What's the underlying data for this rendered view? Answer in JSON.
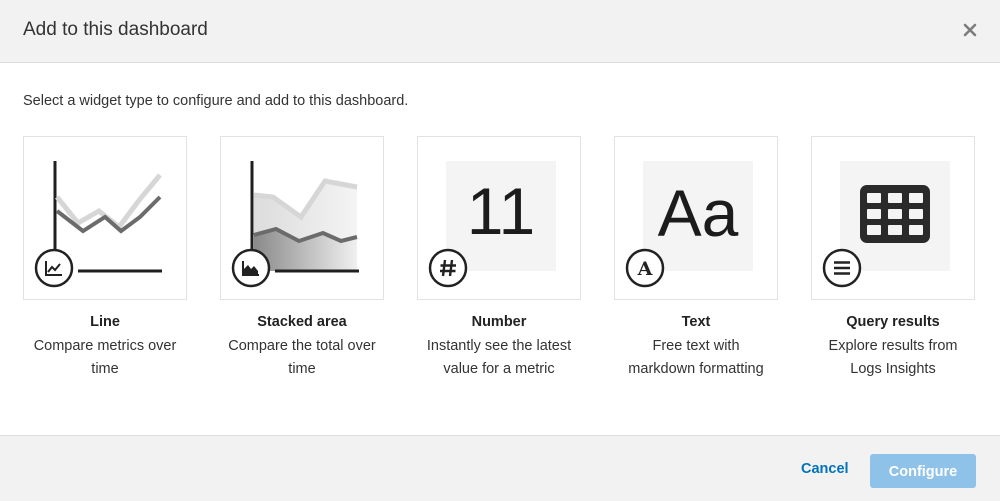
{
  "modal": {
    "title": "Add to this dashboard",
    "close_icon": "close-x-icon",
    "instruction": "Select a widget type to configure and add to this dashboard."
  },
  "widgets": [
    {
      "name": "Line",
      "desc_line1": "Compare metrics over",
      "desc_line2": "time",
      "icon": "line-chart-icon"
    },
    {
      "name": "Stacked area",
      "desc_line1": "Compare the total over",
      "desc_line2": "time",
      "icon": "area-chart-icon"
    },
    {
      "name": "Number",
      "desc_line1": "Instantly see the latest",
      "desc_line2": "value for a metric",
      "icon": "hash-icon",
      "preview_text": "11"
    },
    {
      "name": "Text",
      "desc_line1": "Free text with",
      "desc_line2": "markdown formatting",
      "icon": "letter-a-icon",
      "preview_text": "Aa"
    },
    {
      "name": "Query results",
      "desc_line1": "Explore results from",
      "desc_line2": "Logs Insights",
      "icon": "list-icon"
    }
  ],
  "footer": {
    "cancel_label": "Cancel",
    "configure_label": "Configure"
  },
  "colors": {
    "link": "#0073bb",
    "button_disabled": "#8fc2e8",
    "header_bg": "#f2f2f2"
  }
}
